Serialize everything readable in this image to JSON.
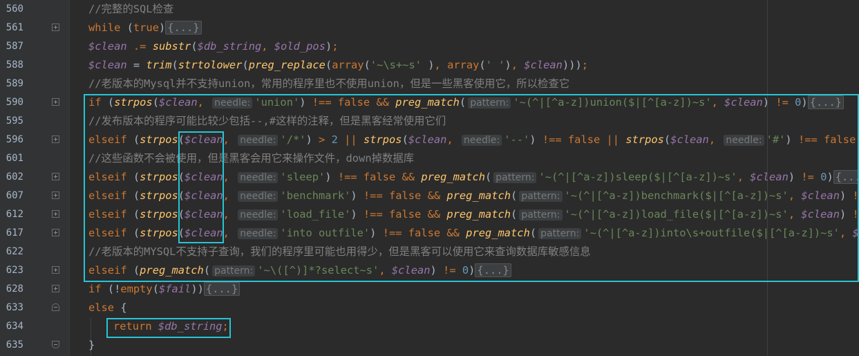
{
  "editor": {
    "lines": [
      {
        "num": "560",
        "fold": "",
        "indent": false,
        "tokens": [
          {
            "t": "c",
            "v": "//完整的SQL检查"
          }
        ]
      },
      {
        "num": "561",
        "fold": "plus",
        "indent": false,
        "tokens": [
          {
            "t": "k",
            "v": "while "
          },
          {
            "t": "p",
            "v": "("
          },
          {
            "t": "k",
            "v": "true"
          },
          {
            "t": "p",
            "v": ")"
          },
          {
            "t": "folded",
            "v": "{...}"
          }
        ]
      },
      {
        "num": "587",
        "fold": "",
        "indent": false,
        "tokens": [
          {
            "t": "v",
            "v": "$clean"
          },
          {
            "t": "p",
            "v": " "
          },
          {
            "t": "k",
            "v": ".="
          },
          {
            "t": "p",
            "v": " "
          },
          {
            "t": "f",
            "v": "substr"
          },
          {
            "t": "p",
            "v": "("
          },
          {
            "t": "v",
            "v": "$db_string"
          },
          {
            "t": "k",
            "v": ", "
          },
          {
            "t": "v",
            "v": "$old_pos"
          },
          {
            "t": "p",
            "v": ")"
          },
          {
            "t": "k",
            "v": ";"
          }
        ]
      },
      {
        "num": "588",
        "fold": "",
        "indent": false,
        "tokens": [
          {
            "t": "v",
            "v": "$clean"
          },
          {
            "t": "p",
            "v": " = "
          },
          {
            "t": "f",
            "v": "trim"
          },
          {
            "t": "p",
            "v": "("
          },
          {
            "t": "f",
            "v": "strtolower"
          },
          {
            "t": "p",
            "v": "("
          },
          {
            "t": "f",
            "v": "preg_replace"
          },
          {
            "t": "p",
            "v": "("
          },
          {
            "t": "k",
            "v": "array"
          },
          {
            "t": "p",
            "v": "("
          },
          {
            "t": "s",
            "v": "'~\\s+~s'"
          },
          {
            "t": "p",
            "v": " )"
          },
          {
            "t": "k",
            "v": ", "
          },
          {
            "t": "k",
            "v": "array"
          },
          {
            "t": "p",
            "v": "("
          },
          {
            "t": "s",
            "v": "' '"
          },
          {
            "t": "p",
            "v": ")"
          },
          {
            "t": "k",
            "v": ", "
          },
          {
            "t": "v",
            "v": "$clean"
          },
          {
            "t": "p",
            "v": ")))"
          },
          {
            "t": "k",
            "v": ";"
          }
        ]
      },
      {
        "num": "589",
        "fold": "",
        "indent": false,
        "tokens": [
          {
            "t": "c",
            "v": "//老版本的Mysql并不支持union，常用的程序里也不使用union，但是一些黑客使用它，所以检查它"
          }
        ]
      },
      {
        "num": "590",
        "fold": "plus",
        "indent": false,
        "tokens": [
          {
            "t": "k",
            "v": "if "
          },
          {
            "t": "p",
            "v": "("
          },
          {
            "t": "f",
            "v": "strpos"
          },
          {
            "t": "p",
            "v": "("
          },
          {
            "t": "v",
            "v": "$clean"
          },
          {
            "t": "k",
            "v": ", "
          },
          {
            "t": "hint",
            "v": "needle:"
          },
          {
            "t": "s",
            "v": "'union'"
          },
          {
            "t": "p",
            "v": ") "
          },
          {
            "t": "k",
            "v": "!== false && "
          },
          {
            "t": "f",
            "v": "preg_match"
          },
          {
            "t": "p",
            "v": "("
          },
          {
            "t": "hint",
            "v": "pattern:"
          },
          {
            "t": "s",
            "v": "'~(^|[^a-z])union($|[^[a-z])~s'"
          },
          {
            "t": "k",
            "v": ", "
          },
          {
            "t": "v",
            "v": "$clean"
          },
          {
            "t": "p",
            "v": ") "
          },
          {
            "t": "k",
            "v": "!= "
          },
          {
            "t": "n",
            "v": "0"
          },
          {
            "t": "p",
            "v": ")"
          },
          {
            "t": "folded",
            "v": "{...}"
          }
        ]
      },
      {
        "num": "595",
        "fold": "",
        "indent": false,
        "tokens": [
          {
            "t": "c",
            "v": "//发布版本的程序可能比较少包括--,#这样的注释，但是黑客经常使用它们"
          }
        ]
      },
      {
        "num": "596",
        "fold": "plus",
        "indent": false,
        "tokens": [
          {
            "t": "k",
            "v": "elseif "
          },
          {
            "t": "p",
            "v": "("
          },
          {
            "t": "f",
            "v": "strpos"
          },
          {
            "t": "p",
            "v": "("
          },
          {
            "t": "v",
            "v": "$clean"
          },
          {
            "t": "k",
            "v": ", "
          },
          {
            "t": "hint",
            "v": "needle:"
          },
          {
            "t": "s",
            "v": "'/*'"
          },
          {
            "t": "p",
            "v": ") "
          },
          {
            "t": "k",
            "v": "> "
          },
          {
            "t": "n",
            "v": "2"
          },
          {
            "t": "k",
            "v": " || "
          },
          {
            "t": "f",
            "v": "strpos"
          },
          {
            "t": "p",
            "v": "("
          },
          {
            "t": "v",
            "v": "$clean"
          },
          {
            "t": "k",
            "v": ", "
          },
          {
            "t": "hint",
            "v": "needle:"
          },
          {
            "t": "s",
            "v": "'--'"
          },
          {
            "t": "p",
            "v": ") "
          },
          {
            "t": "k",
            "v": "!== false || "
          },
          {
            "t": "f",
            "v": "strpos"
          },
          {
            "t": "p",
            "v": "("
          },
          {
            "t": "v",
            "v": "$clean"
          },
          {
            "t": "k",
            "v": ", "
          },
          {
            "t": "hint",
            "v": "needle:"
          },
          {
            "t": "s",
            "v": "'#'"
          },
          {
            "t": "p",
            "v": ") "
          },
          {
            "t": "k",
            "v": "!== false"
          },
          {
            "t": "p",
            "v": ")"
          }
        ]
      },
      {
        "num": "601",
        "fold": "",
        "indent": false,
        "tokens": [
          {
            "t": "c",
            "v": "//这些函数不会被使用，但是黑客会用它来操作文件，down掉数据库"
          }
        ]
      },
      {
        "num": "602",
        "fold": "plus",
        "indent": false,
        "tokens": [
          {
            "t": "k",
            "v": "elseif "
          },
          {
            "t": "p",
            "v": "("
          },
          {
            "t": "f",
            "v": "strpos"
          },
          {
            "t": "p",
            "v": "("
          },
          {
            "t": "v",
            "v": "$clean"
          },
          {
            "t": "k",
            "v": ", "
          },
          {
            "t": "hint",
            "v": "needle:"
          },
          {
            "t": "s",
            "v": "'sleep'"
          },
          {
            "t": "p",
            "v": ") "
          },
          {
            "t": "k",
            "v": "!== false && "
          },
          {
            "t": "f",
            "v": "preg_match"
          },
          {
            "t": "p",
            "v": "("
          },
          {
            "t": "hint",
            "v": "pattern:"
          },
          {
            "t": "s",
            "v": "'~(^|[^a-z])sleep($|[^[a-z])~s'"
          },
          {
            "t": "k",
            "v": ", "
          },
          {
            "t": "v",
            "v": "$clean"
          },
          {
            "t": "p",
            "v": ") "
          },
          {
            "t": "k",
            "v": "!= "
          },
          {
            "t": "n",
            "v": "0"
          },
          {
            "t": "p",
            "v": ")"
          },
          {
            "t": "folded",
            "v": "{...}"
          }
        ]
      },
      {
        "num": "607",
        "fold": "plus",
        "indent": false,
        "tokens": [
          {
            "t": "k",
            "v": "elseif "
          },
          {
            "t": "p",
            "v": "("
          },
          {
            "t": "f",
            "v": "strpos"
          },
          {
            "t": "p",
            "v": "("
          },
          {
            "t": "v",
            "v": "$clean"
          },
          {
            "t": "k",
            "v": ", "
          },
          {
            "t": "hint",
            "v": "needle:"
          },
          {
            "t": "s",
            "v": "'benchmark'"
          },
          {
            "t": "p",
            "v": ") "
          },
          {
            "t": "k",
            "v": "!== false && "
          },
          {
            "t": "f",
            "v": "preg_match"
          },
          {
            "t": "p",
            "v": "("
          },
          {
            "t": "hint",
            "v": "pattern:"
          },
          {
            "t": "s",
            "v": "'~(^|[^a-z])benchmark($|[^[a-z])~s'"
          },
          {
            "t": "k",
            "v": ", "
          },
          {
            "t": "v",
            "v": "$clean"
          },
          {
            "t": "p",
            "v": ") "
          },
          {
            "t": "k",
            "v": "!="
          }
        ]
      },
      {
        "num": "612",
        "fold": "plus",
        "indent": false,
        "tokens": [
          {
            "t": "k",
            "v": "elseif "
          },
          {
            "t": "p",
            "v": "("
          },
          {
            "t": "f",
            "v": "strpos"
          },
          {
            "t": "p",
            "v": "("
          },
          {
            "t": "v",
            "v": "$clean"
          },
          {
            "t": "k",
            "v": ", "
          },
          {
            "t": "hint",
            "v": "needle:"
          },
          {
            "t": "s",
            "v": "'load_file'"
          },
          {
            "t": "p",
            "v": ") "
          },
          {
            "t": "k",
            "v": "!== false && "
          },
          {
            "t": "f",
            "v": "preg_match"
          },
          {
            "t": "p",
            "v": "("
          },
          {
            "t": "hint",
            "v": "pattern:"
          },
          {
            "t": "s",
            "v": "'~(^|[^a-z])load_file($|[^[a-z])~s'"
          },
          {
            "t": "k",
            "v": ", "
          },
          {
            "t": "v",
            "v": "$clean"
          },
          {
            "t": "p",
            "v": ") "
          },
          {
            "t": "k",
            "v": "!="
          }
        ]
      },
      {
        "num": "617",
        "fold": "plus",
        "indent": false,
        "tokens": [
          {
            "t": "k",
            "v": "elseif "
          },
          {
            "t": "p",
            "v": "("
          },
          {
            "t": "f",
            "v": "strpos"
          },
          {
            "t": "p",
            "v": "("
          },
          {
            "t": "v",
            "v": "$clean"
          },
          {
            "t": "k",
            "v": ", "
          },
          {
            "t": "hint",
            "v": "needle:"
          },
          {
            "t": "s",
            "v": "'into outfile'"
          },
          {
            "t": "p",
            "v": ") "
          },
          {
            "t": "k",
            "v": "!== false && "
          },
          {
            "t": "f",
            "v": "preg_match"
          },
          {
            "t": "p",
            "v": "("
          },
          {
            "t": "hint",
            "v": "pattern:"
          },
          {
            "t": "s",
            "v": "'~(^|[^a-z])into\\s+outfile($|[^[a-z])~s'"
          },
          {
            "t": "k",
            "v": ", "
          },
          {
            "t": "v",
            "v": "$c"
          }
        ]
      },
      {
        "num": "622",
        "fold": "",
        "indent": false,
        "tokens": [
          {
            "t": "c",
            "v": "//老版本的MYSQL不支持子查询，我们的程序里可能也用得少，但是黑客可以使用它来查询数据库敏感信息"
          }
        ]
      },
      {
        "num": "623",
        "fold": "plus",
        "indent": false,
        "tokens": [
          {
            "t": "k",
            "v": "elseif "
          },
          {
            "t": "p",
            "v": "("
          },
          {
            "t": "f",
            "v": "preg_match"
          },
          {
            "t": "p",
            "v": "("
          },
          {
            "t": "hint",
            "v": "pattern:"
          },
          {
            "t": "s",
            "v": "'~\\([^)]*?select~s'"
          },
          {
            "t": "k",
            "v": ", "
          },
          {
            "t": "v",
            "v": "$clean"
          },
          {
            "t": "p",
            "v": ") "
          },
          {
            "t": "k",
            "v": "!= "
          },
          {
            "t": "n",
            "v": "0"
          },
          {
            "t": "p",
            "v": ")"
          },
          {
            "t": "folded",
            "v": "{...}"
          }
        ]
      },
      {
        "num": "628",
        "fold": "plus",
        "indent": false,
        "tokens": [
          {
            "t": "k",
            "v": "if "
          },
          {
            "t": "p",
            "v": "(!"
          },
          {
            "t": "k",
            "v": "empty"
          },
          {
            "t": "p",
            "v": "("
          },
          {
            "t": "v",
            "v": "$fail"
          },
          {
            "t": "p",
            "v": "))"
          },
          {
            "t": "folded",
            "v": "{...}"
          }
        ]
      },
      {
        "num": "633",
        "fold": "start",
        "indent": false,
        "tokens": [
          {
            "t": "k",
            "v": "else "
          },
          {
            "t": "p",
            "v": "{"
          }
        ]
      },
      {
        "num": "634",
        "fold": "",
        "indent": true,
        "tokens": [
          {
            "t": "k",
            "v": "return "
          },
          {
            "t": "v",
            "v": "$db_string"
          },
          {
            "t": "k",
            "v": ";"
          }
        ]
      },
      {
        "num": "635",
        "fold": "end",
        "indent": false,
        "tokens": [
          {
            "t": "p",
            "v": "}"
          }
        ]
      }
    ]
  }
}
